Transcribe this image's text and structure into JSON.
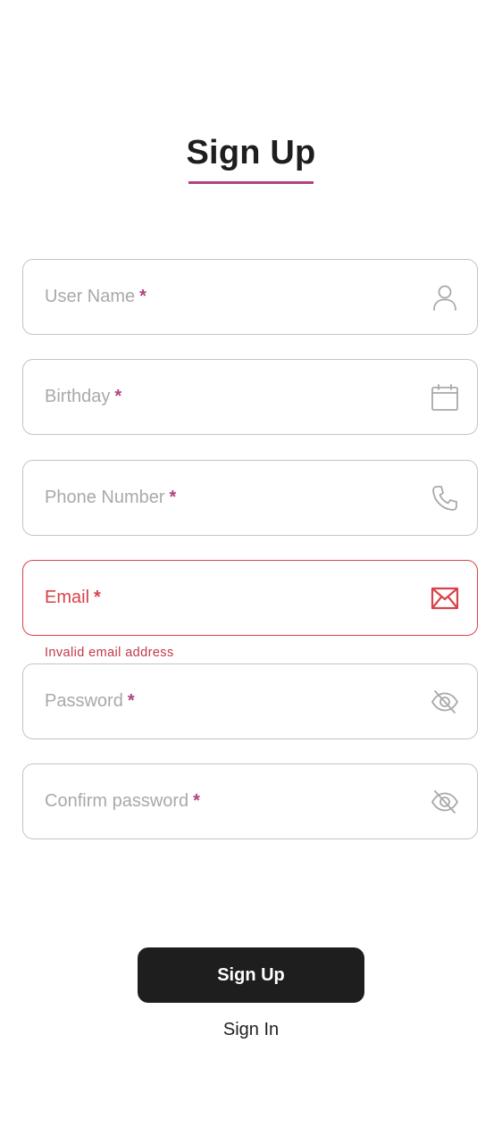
{
  "header": {
    "title": "Sign Up"
  },
  "fields": [
    {
      "label": "User Name",
      "required": "*",
      "icon": "user-icon"
    },
    {
      "label": "Birthday",
      "required": "*",
      "icon": "calendar-icon"
    },
    {
      "label": "Phone Number",
      "required": "*",
      "icon": "phone-icon"
    },
    {
      "label": "Email",
      "required": "*",
      "icon": "mail-icon",
      "error": "Invalid email address"
    },
    {
      "label": "Password",
      "required": "*",
      "icon": "eye-off-icon"
    },
    {
      "label": "Confirm password",
      "required": "*",
      "icon": "eye-off-icon"
    }
  ],
  "actions": {
    "submit_label": "Sign Up",
    "secondary_label": "Sign In"
  },
  "colors": {
    "accent": "#b0437f",
    "error": "#d9424a",
    "button": "#1e1e1e",
    "border": "#c4c4c4",
    "placeholder": "#a9a9a9"
  }
}
